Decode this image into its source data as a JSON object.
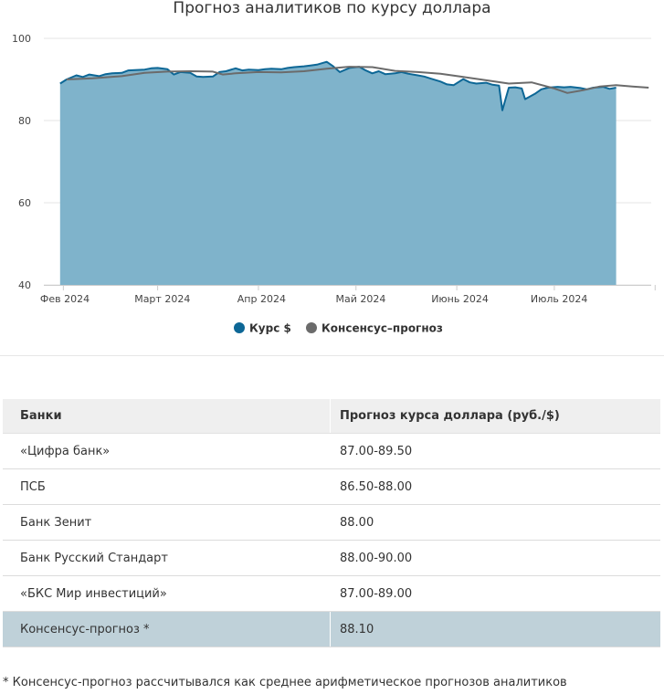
{
  "chart_data": {
    "type": "area",
    "title": "Прогноз аналитиков по курсу доллара",
    "xlabel": "",
    "ylabel": "",
    "ylim": [
      40,
      100
    ],
    "yticks": [
      40,
      60,
      80,
      100
    ],
    "x_tick_labels": [
      "Фев 2024",
      "Март 2024",
      "Апр 2024",
      "Май 2024",
      "Июнь 2024",
      "Июль 2024"
    ],
    "grid": true,
    "legend_position": "bottom-center",
    "series": [
      {
        "name": "Курс $",
        "type": "area",
        "color": "#0d6796",
        "fill": "#7fb3cb",
        "points": [
          [
            "2024-01-31",
            89.0
          ],
          [
            "2024-02-02",
            90.0
          ],
          [
            "2024-02-05",
            91.0
          ],
          [
            "2024-02-07",
            90.6
          ],
          [
            "2024-02-09",
            91.2
          ],
          [
            "2024-02-12",
            90.8
          ],
          [
            "2024-02-14",
            91.3
          ],
          [
            "2024-02-16",
            91.5
          ],
          [
            "2024-02-19",
            91.6
          ],
          [
            "2024-02-21",
            92.2
          ],
          [
            "2024-02-23",
            92.3
          ],
          [
            "2024-02-26",
            92.4
          ],
          [
            "2024-02-28",
            92.7
          ],
          [
            "2024-03-01",
            92.8
          ],
          [
            "2024-03-04",
            92.5
          ],
          [
            "2024-03-06",
            91.2
          ],
          [
            "2024-03-08",
            91.8
          ],
          [
            "2024-03-11",
            91.6
          ],
          [
            "2024-03-13",
            90.7
          ],
          [
            "2024-03-15",
            90.6
          ],
          [
            "2024-03-18",
            90.7
          ],
          [
            "2024-03-20",
            91.8
          ],
          [
            "2024-03-22",
            92.0
          ],
          [
            "2024-03-25",
            92.7
          ],
          [
            "2024-03-27",
            92.2
          ],
          [
            "2024-03-29",
            92.4
          ],
          [
            "2024-04-01",
            92.3
          ],
          [
            "2024-04-03",
            92.5
          ],
          [
            "2024-04-05",
            92.6
          ],
          [
            "2024-04-08",
            92.5
          ],
          [
            "2024-04-10",
            92.8
          ],
          [
            "2024-04-12",
            93.0
          ],
          [
            "2024-04-15",
            93.2
          ],
          [
            "2024-04-17",
            93.4
          ],
          [
            "2024-04-19",
            93.6
          ],
          [
            "2024-04-22",
            94.3
          ],
          [
            "2024-04-24",
            93.2
          ],
          [
            "2024-04-26",
            91.8
          ],
          [
            "2024-04-29",
            92.8
          ],
          [
            "2024-05-02",
            93.1
          ],
          [
            "2024-05-04",
            92.2
          ],
          [
            "2024-05-06",
            91.5
          ],
          [
            "2024-05-08",
            92.0
          ],
          [
            "2024-05-10",
            91.3
          ],
          [
            "2024-05-13",
            91.5
          ],
          [
            "2024-05-15",
            91.8
          ],
          [
            "2024-05-17",
            91.4
          ],
          [
            "2024-05-20",
            91.0
          ],
          [
            "2024-05-22",
            90.7
          ],
          [
            "2024-05-24",
            90.2
          ],
          [
            "2024-05-27",
            89.5
          ],
          [
            "2024-05-29",
            88.8
          ],
          [
            "2024-05-31",
            88.6
          ],
          [
            "2024-06-03",
            90.1
          ],
          [
            "2024-06-05",
            89.3
          ],
          [
            "2024-06-07",
            89.0
          ],
          [
            "2024-06-10",
            89.2
          ],
          [
            "2024-06-12",
            88.7
          ],
          [
            "2024-06-14",
            88.5
          ],
          [
            "2024-06-15",
            82.5
          ],
          [
            "2024-06-17",
            88.0
          ],
          [
            "2024-06-19",
            88.1
          ],
          [
            "2024-06-21",
            87.8
          ],
          [
            "2024-06-22",
            85.2
          ],
          [
            "2024-06-25",
            86.5
          ],
          [
            "2024-06-27",
            87.6
          ],
          [
            "2024-06-29",
            88.0
          ],
          [
            "2024-07-02",
            88.2
          ],
          [
            "2024-07-04",
            88.1
          ],
          [
            "2024-07-06",
            88.2
          ],
          [
            "2024-07-09",
            87.9
          ],
          [
            "2024-07-11",
            87.6
          ],
          [
            "2024-07-13",
            88.0
          ],
          [
            "2024-07-16",
            88.2
          ],
          [
            "2024-07-18",
            87.7
          ],
          [
            "2024-07-20",
            88.0
          ]
        ]
      },
      {
        "name": "Консенсус–прогноз",
        "type": "line",
        "color": "#6b6b6b",
        "points": [
          [
            "2024-02-02",
            90.0
          ],
          [
            "2024-02-10",
            90.3
          ],
          [
            "2024-02-19",
            90.8
          ],
          [
            "2024-02-26",
            91.6
          ],
          [
            "2024-03-04",
            91.9
          ],
          [
            "2024-03-11",
            92.0
          ],
          [
            "2024-03-18",
            91.9
          ],
          [
            "2024-03-21",
            91.2
          ],
          [
            "2024-03-25",
            91.5
          ],
          [
            "2024-04-01",
            91.8
          ],
          [
            "2024-04-08",
            91.7
          ],
          [
            "2024-04-15",
            92.0
          ],
          [
            "2024-04-22",
            92.6
          ],
          [
            "2024-04-29",
            93.1
          ],
          [
            "2024-05-06",
            93.0
          ],
          [
            "2024-05-13",
            92.1
          ],
          [
            "2024-05-20",
            91.8
          ],
          [
            "2024-05-27",
            91.4
          ],
          [
            "2024-06-03",
            90.6
          ],
          [
            "2024-06-10",
            89.8
          ],
          [
            "2024-06-17",
            89.0
          ],
          [
            "2024-06-24",
            89.3
          ],
          [
            "2024-07-01",
            87.8
          ],
          [
            "2024-07-05",
            86.7
          ],
          [
            "2024-07-10",
            87.4
          ],
          [
            "2024-07-15",
            88.3
          ],
          [
            "2024-07-20",
            88.6
          ],
          [
            "2024-07-25",
            88.3
          ],
          [
            "2024-07-30",
            88.0
          ]
        ]
      }
    ]
  },
  "table": {
    "headers": [
      "Банки",
      "Прогноз курса доллара (руб./$)"
    ],
    "rows": [
      [
        "«Цифра банк»",
        "87.00-89.50"
      ],
      [
        "ПСБ",
        "86.50-88.00"
      ],
      [
        "Банк Зенит",
        "88.00"
      ],
      [
        "Банк Русский Стандарт",
        "88.00-90.00"
      ],
      [
        "«БКС Мир инвестиций»",
        "87.00-89.00"
      ],
      [
        "Консенсус-прогноз *",
        "88.10"
      ]
    ]
  },
  "footnote": "* Консенсус-прогноз рассчитывался как среднее арифметическое прогнозов аналитиков"
}
